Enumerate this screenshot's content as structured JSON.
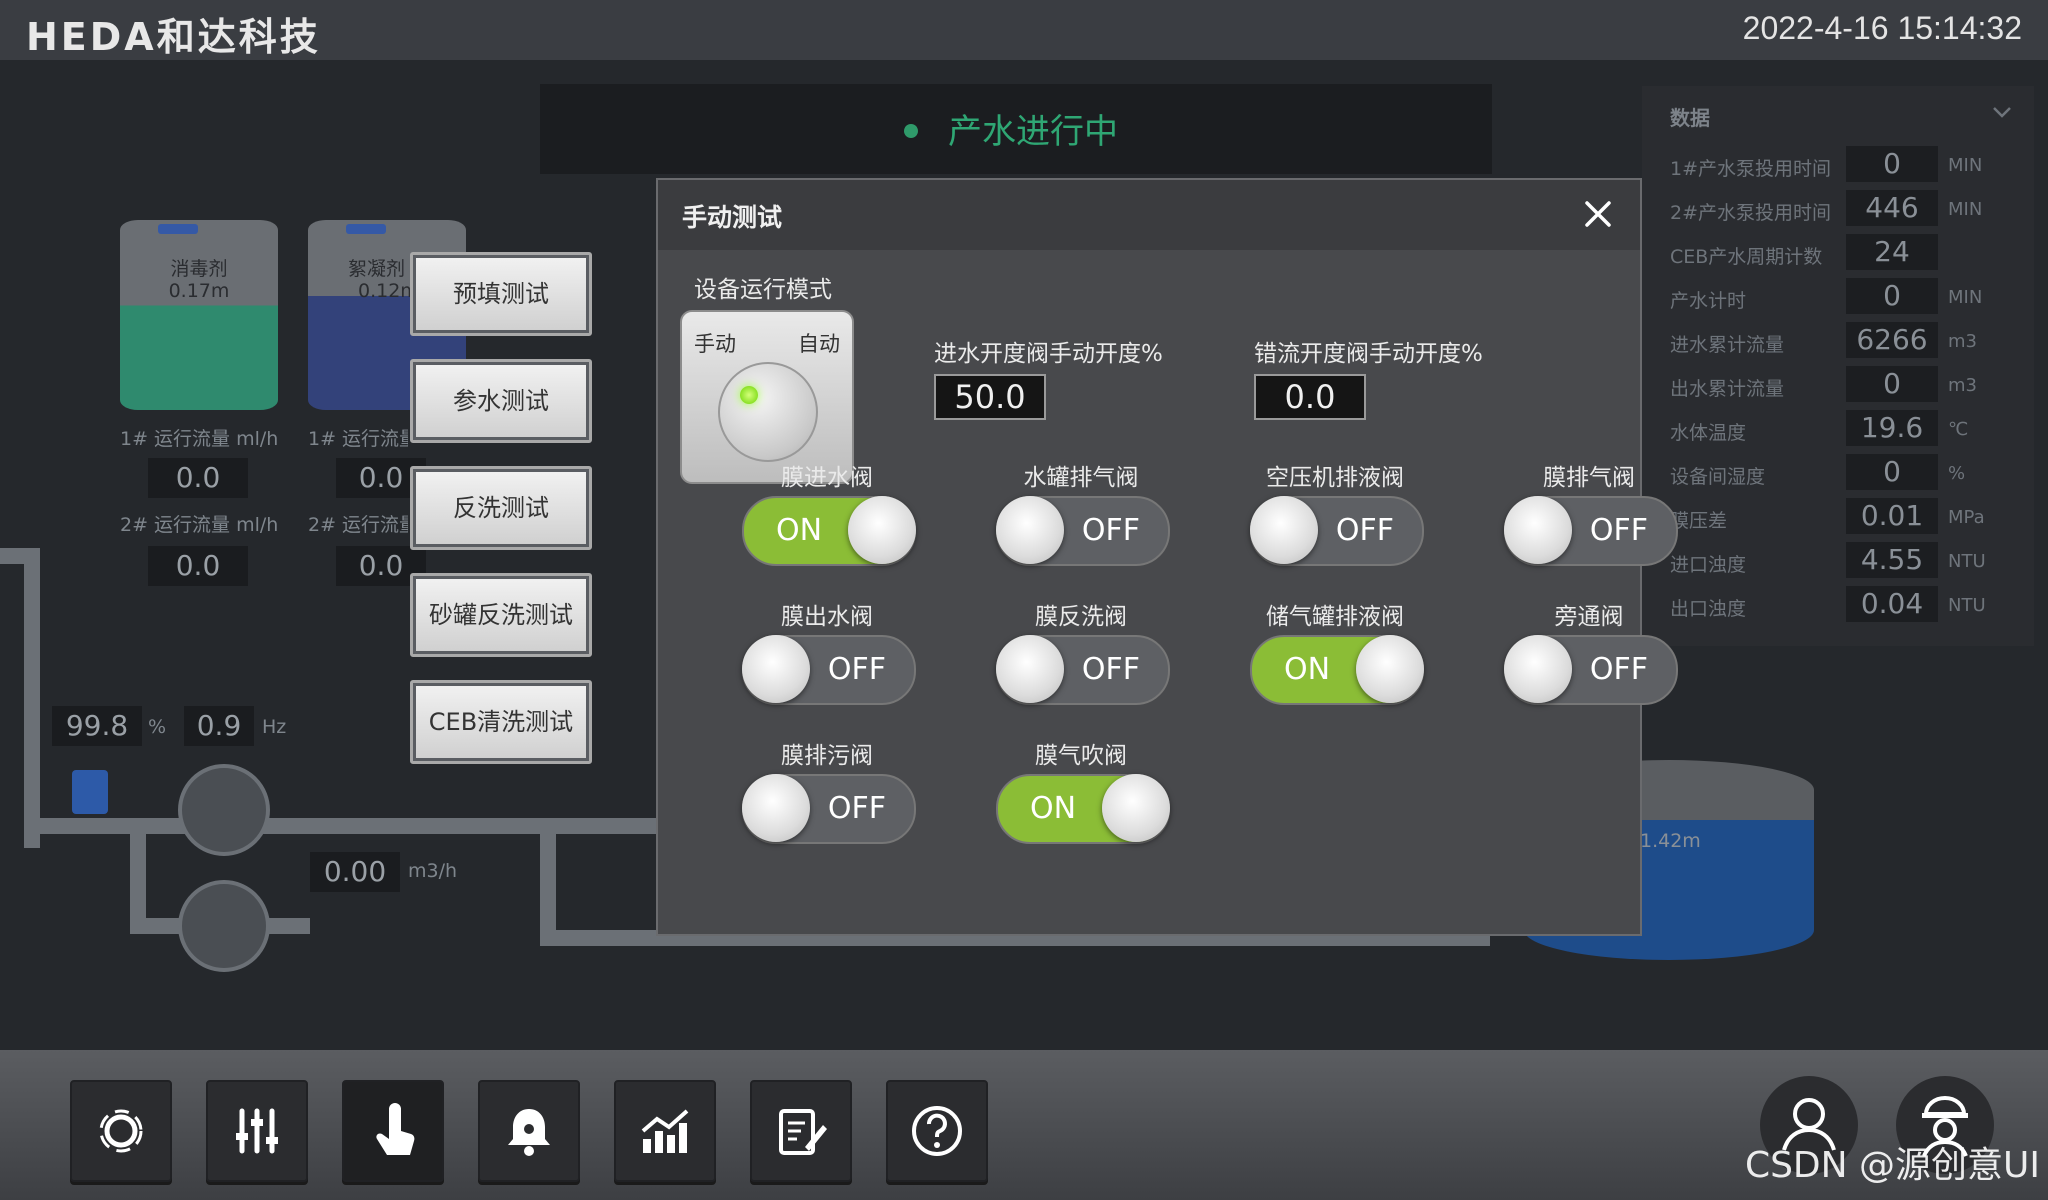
{
  "header": {
    "logo": "HEDA和达科技",
    "datetime": "2022-4-16  15:14:32"
  },
  "status_banner": {
    "text": "产水进行中"
  },
  "background": {
    "tanks": [
      {
        "name": "消毒剂",
        "level": "0.17m"
      },
      {
        "name": "絮凝剂",
        "level": "0.12m"
      }
    ],
    "flow_labels": [
      "1# 运行流量 ml/h",
      "2# 运行流量 ml/h",
      "1# 运行流量",
      "2# 运行流量"
    ],
    "flow_values": [
      "0.0",
      "0.0",
      "0.0",
      "0.0"
    ],
    "pump_percent": "99.8",
    "pump_percent_unit": "%",
    "pump_freq": "0.9",
    "pump_freq_unit": "Hz",
    "flow_rate": "0.00",
    "flow_rate_unit": "m3/h",
    "right_tank_level": "1.42m"
  },
  "side_buttons": [
    "预填测试",
    "参水测试",
    "反洗测试",
    "砂罐反洗测试",
    "CEB清洗测试"
  ],
  "dialog": {
    "title": "手动测试",
    "mode_label": "设备运行模式",
    "mode_manual": "手动",
    "mode_auto": "自动",
    "inlet_label": "进水开度阀手动开度%",
    "inlet_value": "50.0",
    "reject_label": "错流开度阀手动开度%",
    "reject_value": "0.0",
    "toggles": [
      {
        "label": "膜进水阀",
        "state": "ON"
      },
      {
        "label": "水罐排气阀",
        "state": "OFF"
      },
      {
        "label": "空压机排液阀",
        "state": "OFF"
      },
      {
        "label": "膜排气阀",
        "state": "OFF"
      },
      {
        "label": "膜出水阀",
        "state": "OFF"
      },
      {
        "label": "膜反洗阀",
        "state": "OFF"
      },
      {
        "label": "储气罐排液阀",
        "state": "ON"
      },
      {
        "label": "旁通阀",
        "state": "OFF"
      },
      {
        "label": "膜排污阀",
        "state": "OFF"
      },
      {
        "label": "膜气吹阀",
        "state": "ON"
      }
    ]
  },
  "data_panel": {
    "title": "数据",
    "rows": [
      {
        "label": "1#产水泵投用时间",
        "value": "0",
        "unit": "MIN"
      },
      {
        "label": "2#产水泵投用时间",
        "value": "446",
        "unit": "MIN"
      },
      {
        "label": "CEB产水周期计数",
        "value": "24",
        "unit": ""
      },
      {
        "label": "产水计时",
        "value": "0",
        "unit": "MIN"
      },
      {
        "label": "进水累计流量",
        "value": "6266",
        "unit": "m3"
      },
      {
        "label": "出水累计流量",
        "value": "0",
        "unit": "m3"
      },
      {
        "label": "水体温度",
        "value": "19.6",
        "unit": "℃"
      },
      {
        "label": "设备间湿度",
        "value": "0",
        "unit": "%"
      },
      {
        "label": "膜压差",
        "value": "0.01",
        "unit": "MPa"
      },
      {
        "label": "进口浊度",
        "value": "4.55",
        "unit": "NTU"
      },
      {
        "label": "出口浊度",
        "value": "0.04",
        "unit": "NTU"
      }
    ]
  },
  "nav": [
    "monitor-icon",
    "settings-sliders-icon",
    "manual-touch-icon",
    "alarm-bell-icon",
    "trend-chart-icon",
    "report-edit-icon",
    "help-icon"
  ],
  "watermark": "CSDN @源创意UI",
  "colors": {
    "toggle_on": "#8bbd36",
    "toggle_off": "#5e6064",
    "led": "#6ad400"
  }
}
